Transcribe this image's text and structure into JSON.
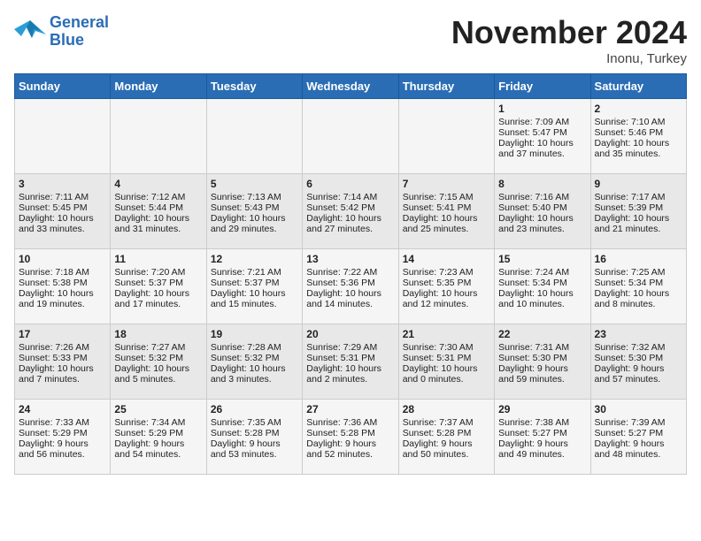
{
  "header": {
    "logo_line1": "General",
    "logo_line2": "Blue",
    "month": "November 2024",
    "location": "Inonu, Turkey"
  },
  "days_of_week": [
    "Sunday",
    "Monday",
    "Tuesday",
    "Wednesday",
    "Thursday",
    "Friday",
    "Saturday"
  ],
  "weeks": [
    [
      {
        "day": "",
        "content": ""
      },
      {
        "day": "",
        "content": ""
      },
      {
        "day": "",
        "content": ""
      },
      {
        "day": "",
        "content": ""
      },
      {
        "day": "",
        "content": ""
      },
      {
        "day": "1",
        "content": "Sunrise: 7:09 AM\nSunset: 5:47 PM\nDaylight: 10 hours\nand 37 minutes."
      },
      {
        "day": "2",
        "content": "Sunrise: 7:10 AM\nSunset: 5:46 PM\nDaylight: 10 hours\nand 35 minutes."
      }
    ],
    [
      {
        "day": "3",
        "content": "Sunrise: 7:11 AM\nSunset: 5:45 PM\nDaylight: 10 hours\nand 33 minutes."
      },
      {
        "day": "4",
        "content": "Sunrise: 7:12 AM\nSunset: 5:44 PM\nDaylight: 10 hours\nand 31 minutes."
      },
      {
        "day": "5",
        "content": "Sunrise: 7:13 AM\nSunset: 5:43 PM\nDaylight: 10 hours\nand 29 minutes."
      },
      {
        "day": "6",
        "content": "Sunrise: 7:14 AM\nSunset: 5:42 PM\nDaylight: 10 hours\nand 27 minutes."
      },
      {
        "day": "7",
        "content": "Sunrise: 7:15 AM\nSunset: 5:41 PM\nDaylight: 10 hours\nand 25 minutes."
      },
      {
        "day": "8",
        "content": "Sunrise: 7:16 AM\nSunset: 5:40 PM\nDaylight: 10 hours\nand 23 minutes."
      },
      {
        "day": "9",
        "content": "Sunrise: 7:17 AM\nSunset: 5:39 PM\nDaylight: 10 hours\nand 21 minutes."
      }
    ],
    [
      {
        "day": "10",
        "content": "Sunrise: 7:18 AM\nSunset: 5:38 PM\nDaylight: 10 hours\nand 19 minutes."
      },
      {
        "day": "11",
        "content": "Sunrise: 7:20 AM\nSunset: 5:37 PM\nDaylight: 10 hours\nand 17 minutes."
      },
      {
        "day": "12",
        "content": "Sunrise: 7:21 AM\nSunset: 5:37 PM\nDaylight: 10 hours\nand 15 minutes."
      },
      {
        "day": "13",
        "content": "Sunrise: 7:22 AM\nSunset: 5:36 PM\nDaylight: 10 hours\nand 14 minutes."
      },
      {
        "day": "14",
        "content": "Sunrise: 7:23 AM\nSunset: 5:35 PM\nDaylight: 10 hours\nand 12 minutes."
      },
      {
        "day": "15",
        "content": "Sunrise: 7:24 AM\nSunset: 5:34 PM\nDaylight: 10 hours\nand 10 minutes."
      },
      {
        "day": "16",
        "content": "Sunrise: 7:25 AM\nSunset: 5:34 PM\nDaylight: 10 hours\nand 8 minutes."
      }
    ],
    [
      {
        "day": "17",
        "content": "Sunrise: 7:26 AM\nSunset: 5:33 PM\nDaylight: 10 hours\nand 7 minutes."
      },
      {
        "day": "18",
        "content": "Sunrise: 7:27 AM\nSunset: 5:32 PM\nDaylight: 10 hours\nand 5 minutes."
      },
      {
        "day": "19",
        "content": "Sunrise: 7:28 AM\nSunset: 5:32 PM\nDaylight: 10 hours\nand 3 minutes."
      },
      {
        "day": "20",
        "content": "Sunrise: 7:29 AM\nSunset: 5:31 PM\nDaylight: 10 hours\nand 2 minutes."
      },
      {
        "day": "21",
        "content": "Sunrise: 7:30 AM\nSunset: 5:31 PM\nDaylight: 10 hours\nand 0 minutes."
      },
      {
        "day": "22",
        "content": "Sunrise: 7:31 AM\nSunset: 5:30 PM\nDaylight: 9 hours\nand 59 minutes."
      },
      {
        "day": "23",
        "content": "Sunrise: 7:32 AM\nSunset: 5:30 PM\nDaylight: 9 hours\nand 57 minutes."
      }
    ],
    [
      {
        "day": "24",
        "content": "Sunrise: 7:33 AM\nSunset: 5:29 PM\nDaylight: 9 hours\nand 56 minutes."
      },
      {
        "day": "25",
        "content": "Sunrise: 7:34 AM\nSunset: 5:29 PM\nDaylight: 9 hours\nand 54 minutes."
      },
      {
        "day": "26",
        "content": "Sunrise: 7:35 AM\nSunset: 5:28 PM\nDaylight: 9 hours\nand 53 minutes."
      },
      {
        "day": "27",
        "content": "Sunrise: 7:36 AM\nSunset: 5:28 PM\nDaylight: 9 hours\nand 52 minutes."
      },
      {
        "day": "28",
        "content": "Sunrise: 7:37 AM\nSunset: 5:28 PM\nDaylight: 9 hours\nand 50 minutes."
      },
      {
        "day": "29",
        "content": "Sunrise: 7:38 AM\nSunset: 5:27 PM\nDaylight: 9 hours\nand 49 minutes."
      },
      {
        "day": "30",
        "content": "Sunrise: 7:39 AM\nSunset: 5:27 PM\nDaylight: 9 hours\nand 48 minutes."
      }
    ]
  ]
}
